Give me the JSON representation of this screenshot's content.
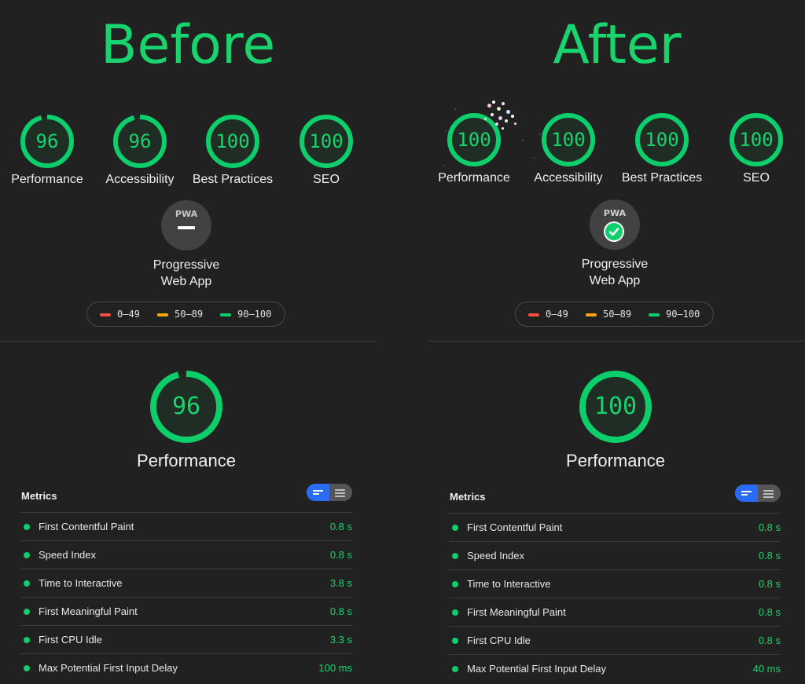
{
  "accent": "#18d36e",
  "before": {
    "title": "Before",
    "gauges": [
      {
        "score": "96",
        "label": "Performance",
        "progress": 0.96
      },
      {
        "score": "96",
        "label": "Accessibility",
        "progress": 0.96
      },
      {
        "score": "100",
        "label": "Best Practices",
        "progress": 1.0
      },
      {
        "score": "100",
        "label": "SEO",
        "progress": 1.0
      }
    ],
    "pwa": {
      "badge_text": "PWA",
      "status_icon": "dash-icon",
      "label_line1": "Progressive",
      "label_line2": "Web App"
    },
    "legend": [
      {
        "range": "0–49",
        "color": "#ff4e42"
      },
      {
        "range": "50–89",
        "color": "#ffa400"
      },
      {
        "range": "90–100",
        "color": "#0cce6b"
      }
    ],
    "performance": {
      "score": "96",
      "label": "Performance",
      "progress": 0.96
    },
    "metrics": {
      "title": "Metrics",
      "rows": [
        {
          "name": "First Contentful Paint",
          "value": "0.8 s"
        },
        {
          "name": "Speed Index",
          "value": "0.8 s"
        },
        {
          "name": "Time to Interactive",
          "value": "3.8 s"
        },
        {
          "name": "First Meaningful Paint",
          "value": "0.8 s"
        },
        {
          "name": "First CPU Idle",
          "value": "3.3 s"
        },
        {
          "name": "Max Potential First Input Delay",
          "value": "100 ms"
        }
      ]
    }
  },
  "after": {
    "title": "After",
    "gauges": [
      {
        "score": "100",
        "label": "Performance",
        "progress": 1.0
      },
      {
        "score": "100",
        "label": "Accessibility",
        "progress": 1.0
      },
      {
        "score": "100",
        "label": "Best Practices",
        "progress": 1.0
      },
      {
        "score": "100",
        "label": "SEO",
        "progress": 1.0
      }
    ],
    "pwa": {
      "badge_text": "PWA",
      "status_icon": "checkmark-icon",
      "label_line1": "Progressive",
      "label_line2": "Web App"
    },
    "legend": [
      {
        "range": "0–49",
        "color": "#ff4e42"
      },
      {
        "range": "50–89",
        "color": "#ffa400"
      },
      {
        "range": "90–100",
        "color": "#0cce6b"
      }
    ],
    "performance": {
      "score": "100",
      "label": "Performance",
      "progress": 1.0
    },
    "metrics": {
      "title": "Metrics",
      "rows": [
        {
          "name": "First Contentful Paint",
          "value": "0.8 s"
        },
        {
          "name": "Speed Index",
          "value": "0.8 s"
        },
        {
          "name": "Time to Interactive",
          "value": "0.8 s"
        },
        {
          "name": "First Meaningful Paint",
          "value": "0.8 s"
        },
        {
          "name": "First CPU Idle",
          "value": "0.8 s"
        },
        {
          "name": "Max Potential First Input Delay",
          "value": "40 ms"
        }
      ]
    }
  }
}
